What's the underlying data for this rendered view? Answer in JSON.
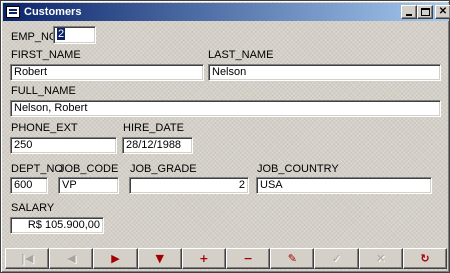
{
  "window": {
    "title": "Customers"
  },
  "fields": {
    "emp_no": {
      "label": "EMP_NO",
      "value": "2"
    },
    "first_name": {
      "label": "FIRST_NAME",
      "value": "Robert"
    },
    "last_name": {
      "label": "LAST_NAME",
      "value": "Nelson"
    },
    "full_name": {
      "label": "FULL_NAME",
      "value": "Nelson, Robert"
    },
    "phone_ext": {
      "label": "PHONE_EXT",
      "value": "250"
    },
    "hire_date": {
      "label": "HIRE_DATE",
      "value": "28/12/1988"
    },
    "dept_no": {
      "label": "DEPT_NO",
      "value": "600"
    },
    "job_code": {
      "label": "JOB_CODE",
      "value": "VP"
    },
    "job_grade": {
      "label": "JOB_GRADE",
      "value": "2"
    },
    "job_country": {
      "label": "JOB_COUNTRY",
      "value": "USA"
    },
    "salary": {
      "label": "SALARY",
      "value": "R$ 105.900,00"
    }
  },
  "navigator": {
    "buttons": [
      {
        "name": "first",
        "glyph": "|◀",
        "state": "disabled"
      },
      {
        "name": "prior",
        "glyph": "◀",
        "state": "disabled"
      },
      {
        "name": "next",
        "glyph": "▶",
        "state": "active"
      },
      {
        "name": "last",
        "glyph": "▼",
        "state": "active"
      },
      {
        "name": "insert",
        "glyph": "+",
        "state": "active"
      },
      {
        "name": "delete",
        "glyph": "−",
        "state": "active"
      },
      {
        "name": "edit",
        "glyph": "✎",
        "state": "active"
      },
      {
        "name": "post",
        "glyph": "✓",
        "state": "disabled"
      },
      {
        "name": "cancel",
        "glyph": "✕",
        "state": "disabled"
      },
      {
        "name": "refresh",
        "glyph": "↻",
        "state": "active"
      }
    ]
  },
  "colors": {
    "titlebar_start": "#0a246a",
    "titlebar_end": "#a6caf0",
    "nav_active": "#a00000",
    "face": "#d4d0c8"
  }
}
